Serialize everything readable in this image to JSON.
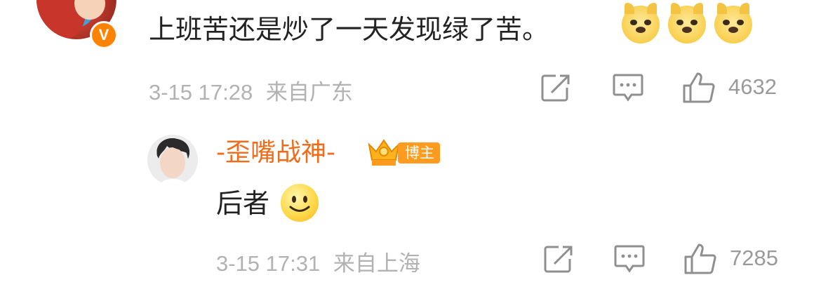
{
  "comment": {
    "text": "上班苦还是炒了一天发现绿了苦。",
    "emojis": [
      "doge-icon",
      "doge-icon",
      "doge-icon"
    ],
    "timestamp": "3-15 17:28",
    "location": "来自广东",
    "like_count": "4632",
    "verified_badge": "V"
  },
  "reply": {
    "username": "-歪嘴战神-",
    "role_badge": "博主",
    "text": "后者",
    "emoji": "smile-icon",
    "timestamp": "3-15 17:31",
    "location": "来自上海",
    "like_count": "7285"
  },
  "colors": {
    "username": "#f06b1a",
    "verified": "#ff8200",
    "badge": "#ff9b1f",
    "meta": "#b2b2b2"
  }
}
